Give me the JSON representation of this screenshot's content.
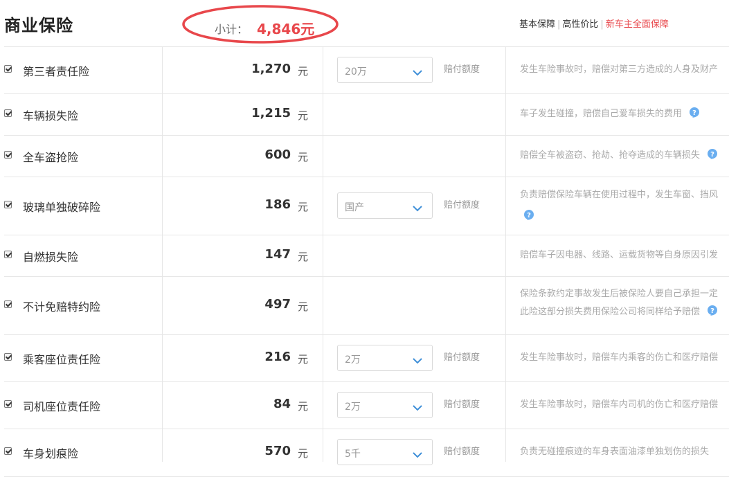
{
  "header": {
    "title": "商业保险",
    "subtotal_label": "小计：",
    "subtotal_value": "4,846元",
    "tabs": [
      {
        "label": "基本保障",
        "active": false
      },
      {
        "label": "高性价比",
        "active": false
      },
      {
        "label": "新车主全面保障",
        "active": true
      }
    ]
  },
  "colors": {
    "accent": "#e8474b",
    "help_icon": "#6aaef0",
    "oval": "#e8474b"
  },
  "rows": [
    {
      "name": "第三者责任险",
      "price": "1,270",
      "unit": "元",
      "select": "20万",
      "limit_label": "赔付额度",
      "desc1": "发生车险事故时，赔偿对第三方造成的人身及财产",
      "desc2": ""
    },
    {
      "name": "车辆损失险",
      "price": "1,215",
      "unit": "元",
      "select": "",
      "limit_label": "",
      "desc1": "车子发生碰撞，赔偿自己爱车损失的费用",
      "desc2": ""
    },
    {
      "name": "全车盗抢险",
      "price": "600",
      "unit": "元",
      "select": "",
      "limit_label": "",
      "desc1": "赔偿全车被盗窃、抢劫、抢夺造成的车辆损失",
      "desc2": ""
    },
    {
      "name": "玻璃单独破碎险",
      "price": "186",
      "unit": "元",
      "select": "国产",
      "limit_label": "赔付额度",
      "desc1": "负责赔偿保险车辆在使用过程中，发生车窗、挡风",
      "desc2": ""
    },
    {
      "name": "自燃损失险",
      "price": "147",
      "unit": "元",
      "select": "",
      "limit_label": "",
      "desc1": "赔偿车子因电器、线路、运载货物等自身原因引发",
      "desc2": ""
    },
    {
      "name": "不计免赔特约险",
      "price": "497",
      "unit": "元",
      "select": "",
      "limit_label": "",
      "desc1": "保险条款约定事故发生后被保险人要自己承担一定",
      "desc2": "此险这部分损失费用保险公司将同样给予赔偿"
    },
    {
      "name": "乘客座位责任险",
      "price": "216",
      "unit": "元",
      "select": "2万",
      "limit_label": "赔付额度",
      "desc1": "发生车险事故时，赔偿车内乘客的伤亡和医疗赔偿",
      "desc2": ""
    },
    {
      "name": "司机座位责任险",
      "price": "84",
      "unit": "元",
      "select": "2万",
      "limit_label": "赔付额度",
      "desc1": "发生车险事故时，赔偿车内司机的伤亡和医疗赔偿",
      "desc2": ""
    },
    {
      "name": "车身划痕险",
      "price": "570",
      "unit": "元",
      "select": "5千",
      "limit_label": "赔付额度",
      "desc1": "负责无碰撞痕迹的车身表面油漆单独划伤的损失",
      "desc2": ""
    }
  ]
}
